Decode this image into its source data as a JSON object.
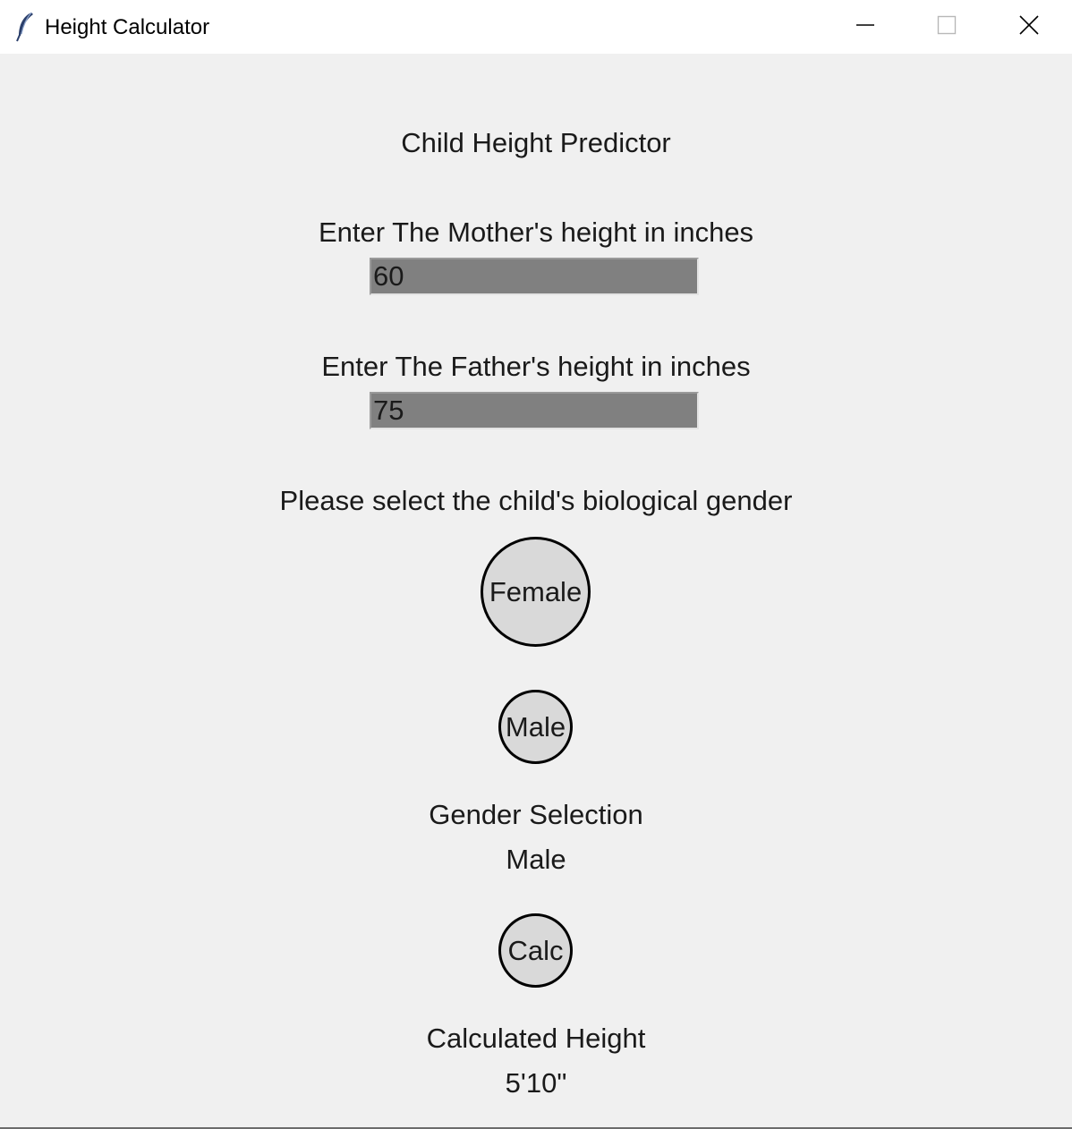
{
  "window": {
    "title": "Height Calculator",
    "app_icon": "feather-icon",
    "controls": {
      "minimize": "minimize-icon",
      "maximize": "maximize-icon",
      "close": "close-icon"
    }
  },
  "main": {
    "heading": "Child Height Predictor",
    "mother": {
      "label": "Enter The Mother's height in inches",
      "value": "60"
    },
    "father": {
      "label": "Enter The Father's height in inches",
      "value": "75"
    },
    "gender_prompt": "Please select the child's biological gender",
    "female_button": "Female",
    "male_button": "Male",
    "gender_selection_label": "Gender Selection",
    "gender_selection_value": "Male",
    "calc_button": "Calc",
    "result_label": "Calculated Height",
    "result_value": "5'10\""
  },
  "colors": {
    "background": "#f0f0f0",
    "entry_background": "#808080",
    "button_background": "#d9d9d9",
    "button_border": "#000000"
  }
}
